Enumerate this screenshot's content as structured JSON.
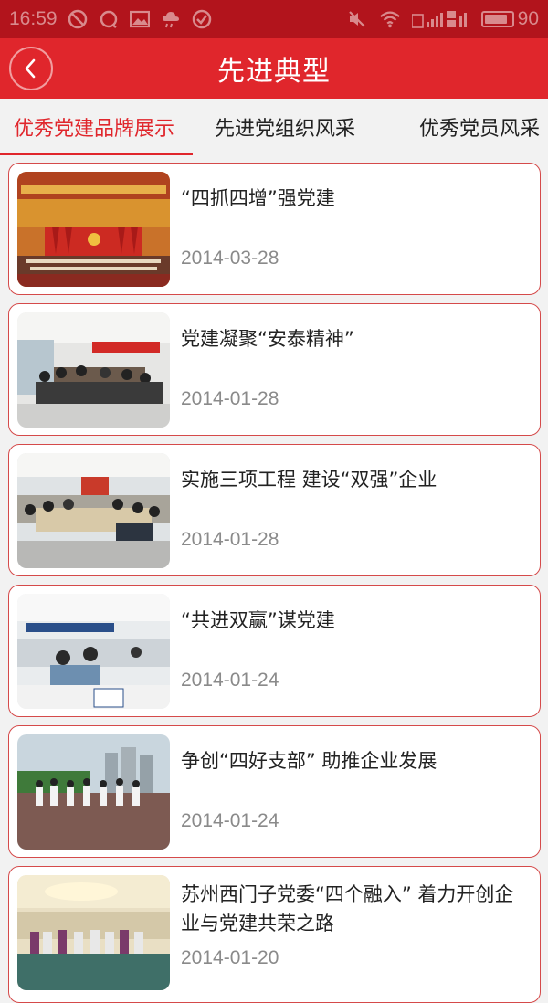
{
  "status_bar": {
    "time": "16:59",
    "battery": "90",
    "battery_level": 0.9
  },
  "header": {
    "title": "先进典型",
    "back_icon": "chevron-left-icon"
  },
  "tabs": [
    {
      "label": "优秀党建品牌展示",
      "active": true
    },
    {
      "label": "先进党组织风采",
      "active": false
    },
    {
      "label": "优秀党员风采",
      "active": false
    }
  ],
  "articles": [
    {
      "title": "“四抓四增”强党建",
      "date": "2014-03-28",
      "image": "auditorium-stage-photo"
    },
    {
      "title": "党建凝聚“安泰精神”",
      "date": "2014-01-28",
      "image": "meeting-room-photo"
    },
    {
      "title": "实施三项工程 建设“双强”企业",
      "date": "2014-01-28",
      "image": "conference-hall-photo"
    },
    {
      "title": "“共进双赢”谋党建",
      "date": "2014-01-24",
      "image": "office-desk-photo"
    },
    {
      "title": "争创“四好支部” 助推企业发展",
      "date": "2014-01-24",
      "image": "running-event-photo"
    },
    {
      "title": "苏州西门子党委“四个融入” 着力开创企业与党建共荣之路",
      "date": "2014-01-20",
      "image": "banquet-hall-photo"
    }
  ],
  "colors": {
    "brand_red": "#e0262c",
    "status_bar": "#b2141c",
    "card_border": "#d54a4a",
    "date_gray": "#8a8a8a"
  }
}
